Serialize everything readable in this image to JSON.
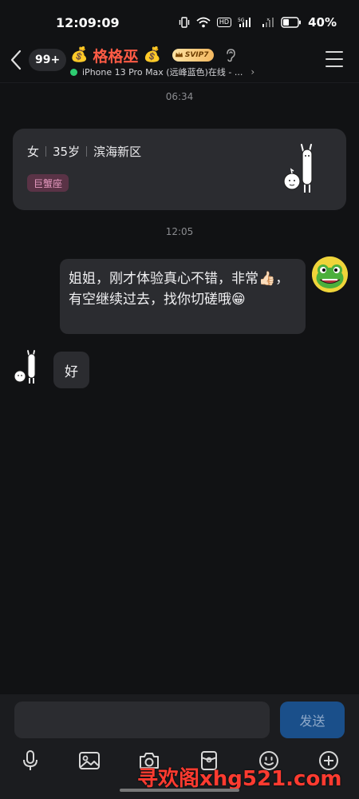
{
  "status_bar": {
    "time": "12:09:09",
    "battery": "40%",
    "hd_label": "HD",
    "signal_label": "5G"
  },
  "header": {
    "unread_count": "99+",
    "money_emoji": "💰",
    "contact_name": "格格巫",
    "svip_label": "SVIP7",
    "online_status": "iPhone 13 Pro Max (远峰蓝色)在线 - ...",
    "online_color": "#2ecc71",
    "name_color": "#ff5b45"
  },
  "chat": {
    "timestamps": [
      "06:34",
      "12:05"
    ],
    "profile": {
      "gender": "女",
      "age": "35岁",
      "location": "滨海新区",
      "zodiac": "巨蟹座"
    },
    "messages": [
      {
        "side": "right",
        "text": "姐姐，刚才体验真心不错，非常👍🏻，有空继续过去，找你切磋哦😁"
      },
      {
        "side": "left",
        "text": "好"
      }
    ]
  },
  "input": {
    "placeholder": "",
    "send_label": "发送"
  },
  "toolbar": {
    "icons": [
      "microphone-icon",
      "image-icon",
      "camera-icon",
      "red-packet-icon",
      "emoji-icon",
      "plus-icon"
    ]
  },
  "watermark": "寻欢阁xhg521.com"
}
